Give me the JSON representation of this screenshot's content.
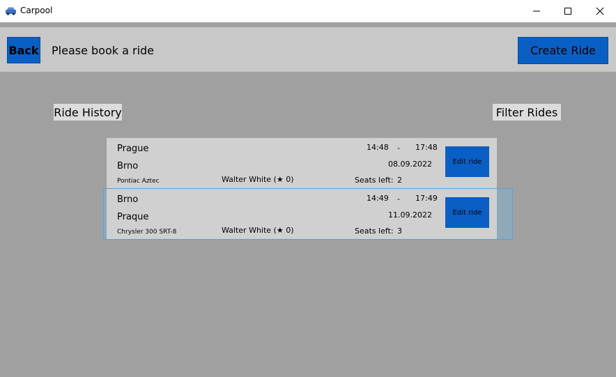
{
  "window": {
    "title": "Carpool",
    "icon": "car-icon"
  },
  "header": {
    "back_label": "Back",
    "title": "Please book a ride",
    "create_label": "Create Ride"
  },
  "sections": {
    "history_label": "Ride History",
    "filter_label": "Filter Rides"
  },
  "rides": [
    {
      "from": "Prague",
      "to": "Brno",
      "car": "Pontiac Aztec",
      "driver": "Walter White (★ 0)",
      "departure": "14:48",
      "separator": "-",
      "arrival": "17:48",
      "date": "08.09.2022",
      "seats_label": "Seats left:",
      "seats": "2",
      "edit_label": "Edit ride"
    },
    {
      "from": "Brno",
      "to": "Praque",
      "car": "Chrysler 300 SRT-8",
      "driver": "Walter White (★ 0)",
      "departure": "14:49",
      "separator": "-",
      "arrival": "17:49",
      "date": "11.09.2022",
      "seats_label": "Seats left:",
      "seats": "3",
      "edit_label": "Edit ride",
      "selected": true
    }
  ],
  "colors": {
    "accent": "#0a5fc4",
    "background": "#a0a0a0",
    "header": "#c8c8c8",
    "selection": "#8fa9bb"
  }
}
